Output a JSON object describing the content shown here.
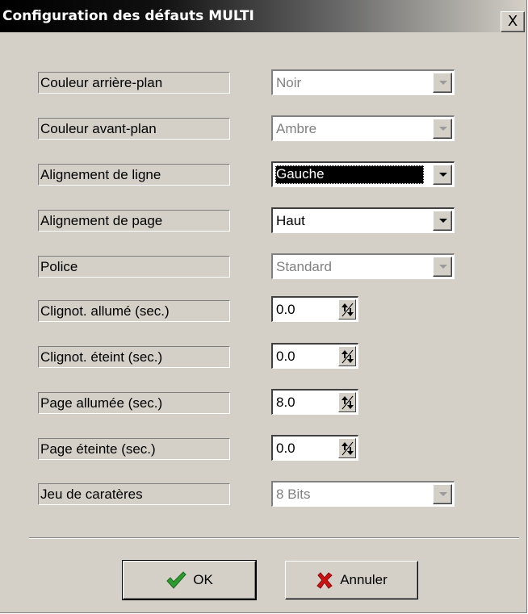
{
  "window": {
    "title": "Configuration des défauts MULTI",
    "close_symbol": "X"
  },
  "fields": [
    {
      "label": "Couleur arrière-plan",
      "type": "combo",
      "value": "Noir",
      "enabled": false
    },
    {
      "label": "Couleur avant-plan",
      "type": "combo",
      "value": "Ambre",
      "enabled": false
    },
    {
      "label": "Alignement de ligne",
      "type": "combo",
      "value": "Gauche",
      "enabled": true,
      "focused": true
    },
    {
      "label": "Alignement de page",
      "type": "combo",
      "value": "Haut",
      "enabled": true
    },
    {
      "label": "Police",
      "type": "combo",
      "value": "Standard",
      "enabled": false
    },
    {
      "label": "Clignot. allumé (sec.)",
      "type": "spin",
      "value": "0.0"
    },
    {
      "label": "Clignot. éteint (sec.)",
      "type": "spin",
      "value": "0.0"
    },
    {
      "label": "Page allumée (sec.)",
      "type": "spin",
      "value": "8.0"
    },
    {
      "label": "Page éteinte (sec.)",
      "type": "spin",
      "value": "0.0"
    },
    {
      "label": "Jeu de caratères",
      "type": "combo",
      "value": "8 Bits",
      "enabled": false
    }
  ],
  "buttons": {
    "ok_label": "OK",
    "ok_icon": "checkmark-icon",
    "cancel_label": "Annuler",
    "cancel_icon": "red-x-icon"
  },
  "colors": {
    "dialog_bg": "#d4d0c8",
    "title_bg": "#000000",
    "ok_icon": "#2e9b2e",
    "cancel_icon": "#d01010"
  }
}
